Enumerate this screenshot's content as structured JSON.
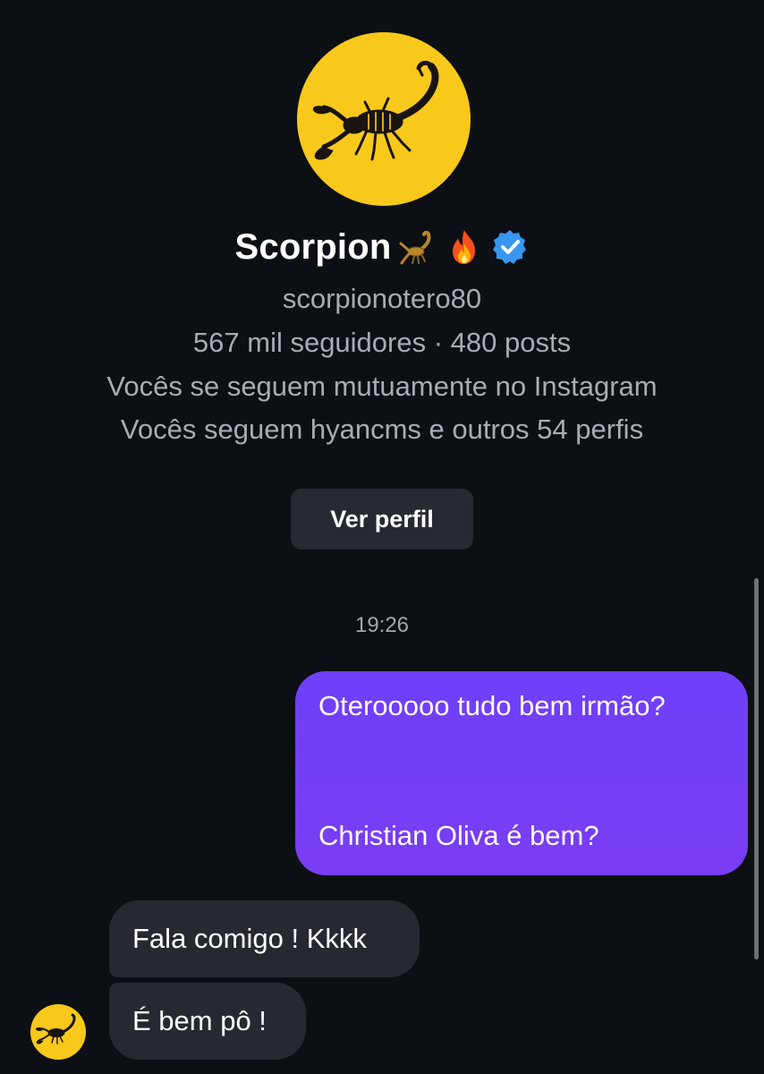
{
  "profile": {
    "display_name": "Scorpion",
    "name_emojis": [
      "scorpion-emoji",
      "fire-emoji"
    ],
    "verified": true,
    "username": "scorpionotero80",
    "stats": "567 mil seguidores · 480 posts",
    "mutual_follow": "Vocês se seguem mutuamente no Instagram",
    "followed_by": "Vocês seguem hyancms e outros 54 perfis",
    "view_profile_label": "Ver perfil"
  },
  "conversation": {
    "timestamp": "19:26",
    "messages": [
      {
        "direction": "outgoing",
        "text_line1": "Oterooooo tudo bem irmão?",
        "text_line2": "Christian Oliva é bem?"
      },
      {
        "direction": "incoming",
        "text": "Fala comigo ! Kkkk"
      },
      {
        "direction": "incoming",
        "text": "É bem pô !"
      }
    ]
  },
  "colors": {
    "background": "#0c0f14",
    "outgoing_bubble": "#7340f7",
    "incoming_bubble": "#262a30",
    "avatar_bg": "#f8c91b",
    "secondary_text": "#a8acb3",
    "verified_badge": "#3797f0"
  }
}
